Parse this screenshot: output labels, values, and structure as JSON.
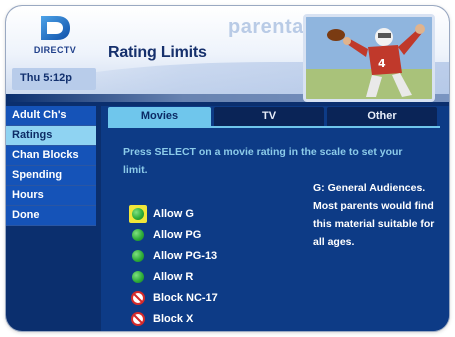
{
  "header": {
    "brand": "DIRECTV",
    "clock": "Thu 5:12p",
    "title": "Rating Limits",
    "watermark": "parental",
    "accent_color": "#1553b8"
  },
  "sidebar": {
    "items": [
      {
        "label": "Adult Ch's",
        "active": false
      },
      {
        "label": "Ratings",
        "active": true
      },
      {
        "label": "Chan Blocks",
        "active": false
      },
      {
        "label": "Spending",
        "active": false
      },
      {
        "label": "Hours",
        "active": false
      },
      {
        "label": "Done",
        "active": false
      }
    ]
  },
  "main": {
    "tabs": [
      {
        "label": "Movies",
        "active": true
      },
      {
        "label": "TV",
        "active": false
      },
      {
        "label": "Other",
        "active": false
      }
    ],
    "instructions": "Press SELECT on a movie rating in the scale to set your limit.",
    "ratings": [
      {
        "label": "Allow G",
        "icon": "allow-dot-icon",
        "selected": true
      },
      {
        "label": "Allow PG",
        "icon": "allow-dot-icon",
        "selected": false
      },
      {
        "label": "Allow PG-13",
        "icon": "allow-dot-icon",
        "selected": false
      },
      {
        "label": "Allow R",
        "icon": "allow-dot-icon",
        "selected": false
      },
      {
        "label": "Block NC-17",
        "icon": "block-icon",
        "selected": false
      },
      {
        "label": "Block X",
        "icon": "block-icon",
        "selected": false
      }
    ],
    "description": "G: General Audiences. Most parents would find this material suitable for all ages."
  }
}
